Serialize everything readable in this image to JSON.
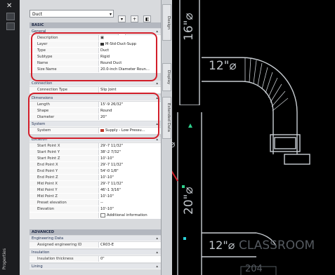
{
  "palette": {
    "close_glyph": "✕",
    "vertical_title": "Properties",
    "top_combo_value": "Duct",
    "top_icons": [
      "▾",
      "+",
      "◧",
      "▦"
    ],
    "tabs": [
      "Design",
      "Display",
      "Extended Data"
    ],
    "basic_header": "BASIC",
    "advanced_header": "ADVANCED",
    "categories": {
      "general": "General",
      "connection": "Connection",
      "dimensions": "Dimensions",
      "system": "System",
      "location": "Location",
      "engineering": "Engineering Data",
      "insulation": "Insulation",
      "lining": "Lining"
    },
    "general": [
      {
        "name": "Description",
        "value": "▣"
      },
      {
        "name": "Layer",
        "value": "M-Std-Duct-Supp"
      },
      {
        "name": "Type",
        "value": "Duct"
      },
      {
        "name": "Subtype",
        "value": "Rigid"
      },
      {
        "name": "Name",
        "value": "Round Duct"
      },
      {
        "name": "Size Name",
        "value": "20.0-inch Diameter Roun..."
      }
    ],
    "connection": [
      {
        "name": "Connection Type",
        "value": "Slip Joint"
      }
    ],
    "dimensions": [
      {
        "name": "Length",
        "value": "15'-9 26/32\""
      },
      {
        "name": "Shape",
        "value": "Round"
      },
      {
        "name": "Diameter",
        "value": "20\""
      }
    ],
    "system": [
      {
        "name": "System",
        "value": "Supply - Low Pressu..."
      }
    ],
    "location": [
      {
        "name": "Start Point X",
        "value": "29'-7 11/32\""
      },
      {
        "name": "Start Point Y",
        "value": "38'-2 7/32\""
      },
      {
        "name": "Start Point Z",
        "value": "10'-10\""
      },
      {
        "name": "End Point X",
        "value": "29'-7 11/32\""
      },
      {
        "name": "End Point Y",
        "value": "54'-0 1/8\""
      },
      {
        "name": "End Point Z",
        "value": "10'-10\""
      },
      {
        "name": "Mid Point X",
        "value": "29'-7 11/32\""
      },
      {
        "name": "Mid Point Y",
        "value": "46'-1 3/16\""
      },
      {
        "name": "Mid Point Z",
        "value": "10'-10\""
      },
      {
        "name": "Preset elevation",
        "value": "--"
      },
      {
        "name": "Elevation",
        "value": "10'-10\""
      },
      {
        "name": "",
        "value": "Additional information"
      }
    ],
    "engineering": [
      {
        "name": "Assigned engineering ID",
        "value": "CR03-E"
      }
    ],
    "insulation": [
      {
        "name": "Insulation thickness",
        "value": "0\""
      }
    ]
  },
  "drawing": {
    "label_top": "16\"⌀",
    "label_mid": "12\"⌀",
    "label_bottom": "20\"⌀",
    "label_left": "⌀",
    "label_lower": "12\"⌀",
    "room_label": "CLASSROOM",
    "room_number": "204"
  },
  "colors": {
    "highlight": "#d21e2a",
    "arrow": "#d21e2a",
    "duct_lines": "#c9ced3",
    "grip_green": "#2fd08c",
    "grip_cyan": "#2ad0d8"
  }
}
